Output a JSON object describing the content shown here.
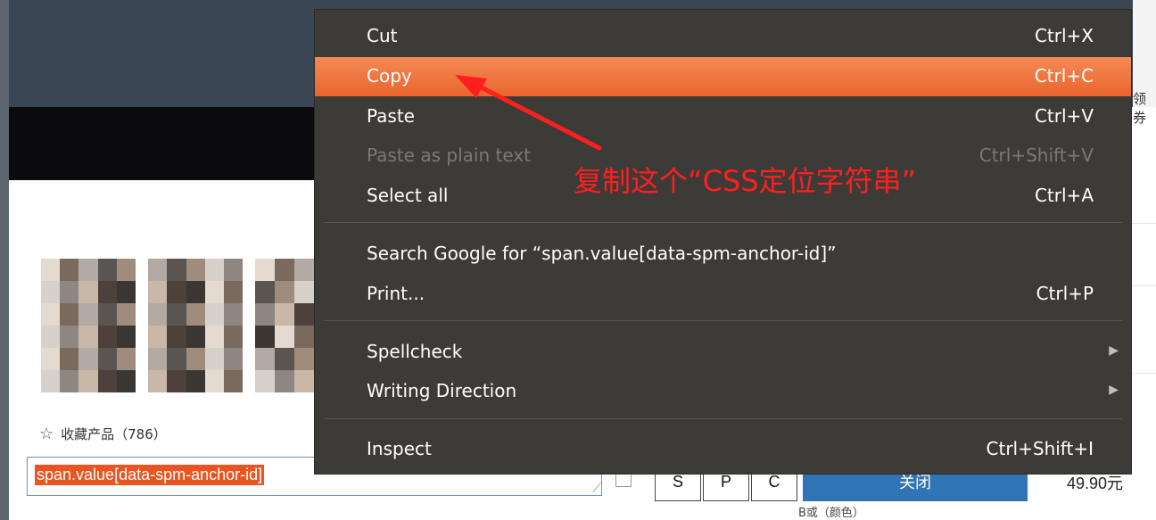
{
  "context_menu": {
    "items": [
      {
        "label": "Cut",
        "shortcut": "Ctrl+X",
        "state": "normal"
      },
      {
        "label": "Copy",
        "shortcut": "Ctrl+C",
        "state": "active"
      },
      {
        "label": "Paste",
        "shortcut": "Ctrl+V",
        "state": "normal"
      },
      {
        "label": "Paste as plain text",
        "shortcut": "Ctrl+Shift+V",
        "state": "disabled"
      },
      {
        "label": "Select all",
        "shortcut": "Ctrl+A",
        "state": "normal"
      },
      {
        "label": "Search Google for “span.value[data-spm-anchor-id]”",
        "shortcut": "",
        "state": "normal"
      },
      {
        "label": "Print...",
        "shortcut": "Ctrl+P",
        "state": "normal"
      },
      {
        "label": "Spellcheck",
        "shortcut": "",
        "state": "submenu"
      },
      {
        "label": "Writing Direction",
        "shortcut": "",
        "state": "submenu"
      },
      {
        "label": "Inspect",
        "shortcut": "Ctrl+Shift+I",
        "state": "normal"
      }
    ]
  },
  "annotation": {
    "text": "复制这个“CSS定位字符串”",
    "color": "#ff1f1f"
  },
  "page": {
    "favorite_label": "收藏产品（786）",
    "css_input_value": "span.value[data-spm-anchor-id]",
    "buttons": [
      "S",
      "P",
      "C"
    ],
    "close_label": "关闭",
    "price": "49.90元",
    "side_text": "领券",
    "bottom_label": "B或（颜色）"
  },
  "colors": {
    "menu_bg": "#3c3b37",
    "menu_active": "#e9652d",
    "selection": "#e95420",
    "close_button": "#2f75b5",
    "top_bar": "#3a4654"
  }
}
